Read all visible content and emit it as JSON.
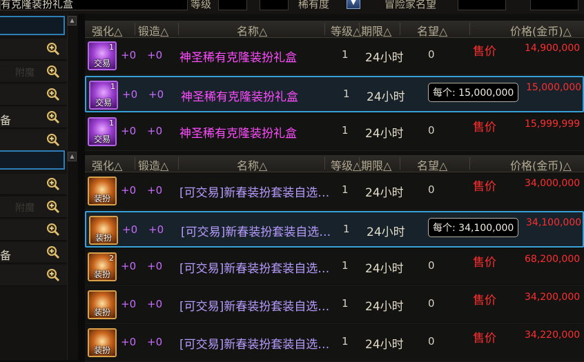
{
  "search": {
    "value": "有克隆装扮礼盒",
    "level_label": "等级",
    "rarity_label": "稀有度",
    "adventurer_label": "冒险家名望"
  },
  "sidebar": {
    "items": [
      {
        "label": ""
      },
      {
        "label": "",
        "faded": "附魔"
      },
      {
        "label": ""
      },
      {
        "label": "备"
      },
      {
        "label": ""
      }
    ],
    "items2": [
      {
        "label": ""
      },
      {
        "label": "",
        "faded": "附魔"
      },
      {
        "label": ""
      },
      {
        "label": "备"
      },
      {
        "label": ""
      }
    ]
  },
  "headers": {
    "strengthen": "强化△",
    "forge": "锻造△",
    "name": "名称△",
    "level": "等级△",
    "duration": "期限△",
    "reputation": "名望△",
    "price": "价格(金币)△"
  },
  "group1": {
    "rows": [
      {
        "count": "1",
        "tag": "交易",
        "str": "+0",
        "forge": "+0",
        "name": "神圣稀有克隆装扮礼盒",
        "level": "1",
        "duration": "24小时",
        "reputation": "0",
        "action": "售价",
        "price": "14,900,000"
      },
      {
        "count": "1",
        "tag": "交易",
        "str": "+0",
        "forge": "+0",
        "name": "神圣稀有克隆装扮礼盒",
        "level": "1",
        "duration": "24小时",
        "reputation": "",
        "action": "",
        "price": "15,000,000",
        "tooltip": "每个: 15,000,000"
      },
      {
        "count": "1",
        "tag": "交易",
        "str": "+0",
        "forge": "+0",
        "name": "神圣稀有克隆装扮礼盒",
        "level": "1",
        "duration": "24小时",
        "reputation": "0",
        "action": "售价",
        "price": "15,999,999"
      }
    ]
  },
  "group2": {
    "rows": [
      {
        "count": "",
        "tag": "装扮",
        "str": "+0",
        "forge": "+0",
        "name": "[可交易]新春装扮套装自选…",
        "level": "1",
        "duration": "24小时",
        "reputation": "0",
        "action": "售价",
        "price": "34,000,000"
      },
      {
        "count": "",
        "tag": "装扮",
        "str": "+0",
        "forge": "+0",
        "name": "[可交易]新春装扮套装自选…",
        "level": "1",
        "duration": "24小时",
        "reputation": "",
        "action": "",
        "price": "34,100,000",
        "tooltip": "每个: 34,100,000"
      },
      {
        "count": "2",
        "tag": "装扮",
        "str": "+0",
        "forge": "+0",
        "name": "[可交易]新春装扮套装自选…",
        "level": "1",
        "duration": "24小时",
        "reputation": "0",
        "action": "售价",
        "price": "68,200,000"
      },
      {
        "count": "",
        "tag": "装扮",
        "str": "+0",
        "forge": "+0",
        "name": "[可交易]新春装扮套装自选…",
        "level": "1",
        "duration": "24小时",
        "reputation": "0",
        "action": "售价",
        "price": "34,200,000"
      },
      {
        "count": "",
        "tag": "装扮",
        "str": "+0",
        "forge": "+0",
        "name": "[可交易]新春装扮套装自选…",
        "level": "1",
        "duration": "24小时",
        "reputation": "0",
        "action": "售价",
        "price": "34,220,000"
      }
    ]
  },
  "colors": {
    "selection_border": "#3aa0d8",
    "price_red": "#ff2f2f",
    "rare_item": "#ff4dff",
    "box_item": "#b79cff"
  }
}
